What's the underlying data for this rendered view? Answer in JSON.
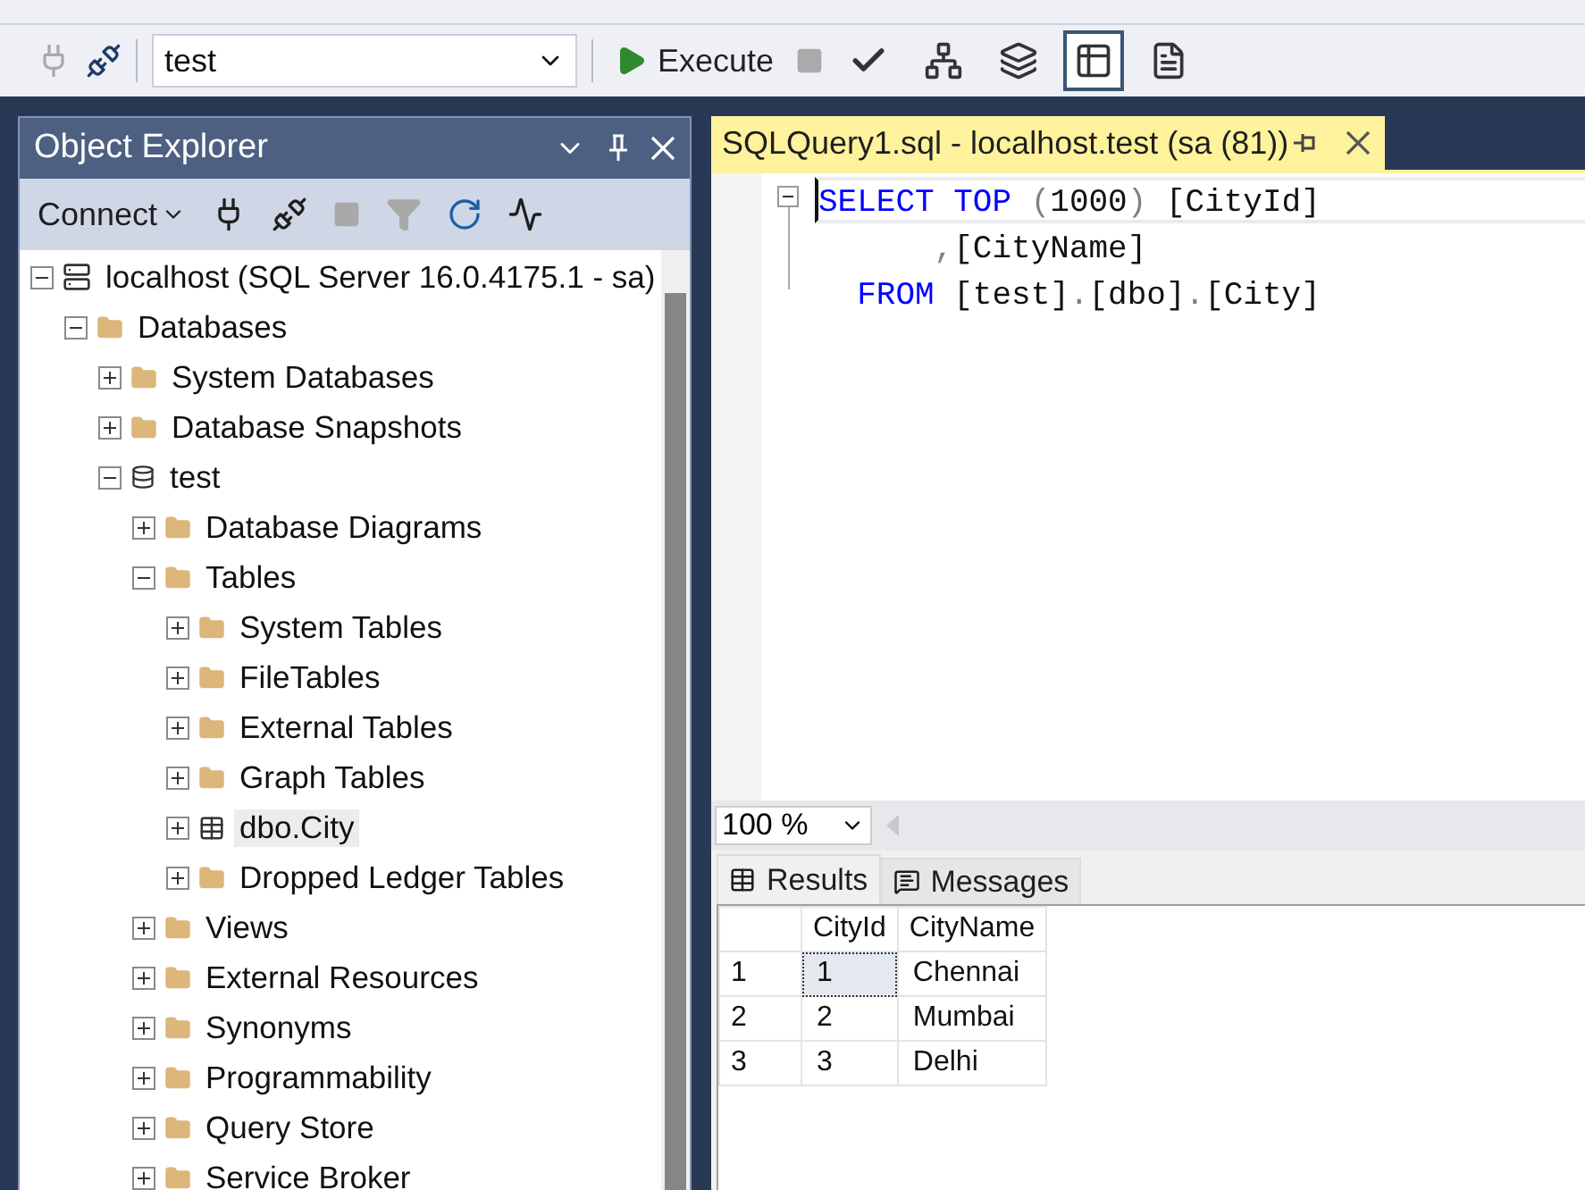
{
  "toolbar": {
    "database": "test",
    "execute": "Execute",
    "buttons": [
      {
        "kind": "check"
      },
      {
        "kind": "plan"
      },
      {
        "kind": "text",
        "selected": false
      },
      {
        "kind": "grid",
        "selected": true
      },
      {
        "kind": "file",
        "selected": false
      }
    ]
  },
  "object_explorer": {
    "title": "Object Explorer",
    "connect": "Connect",
    "tools": [
      {
        "kind": "plug",
        "disabled": false
      },
      {
        "kind": "unplug",
        "disabled": false
      },
      {
        "kind": "stop",
        "disabled": true
      },
      {
        "kind": "filter",
        "disabled": true
      },
      {
        "kind": "refresh",
        "disabled": false
      },
      {
        "kind": "activity",
        "disabled": false
      }
    ],
    "tree": [
      {
        "label": "localhost (SQL Server 16.0.4175.1 - sa)",
        "kind": "server",
        "expanded": true,
        "selected": false,
        "children": [
          {
            "label": "Databases",
            "kind": "folder",
            "expanded": true,
            "selected": false,
            "children": [
              {
                "label": "System Databases",
                "kind": "folder",
                "expanded": false,
                "selected": false
              },
              {
                "label": "Database Snapshots",
                "kind": "folder",
                "expanded": false,
                "selected": false
              },
              {
                "label": "test",
                "kind": "database",
                "expanded": true,
                "selected": false,
                "children": [
                  {
                    "label": "Database Diagrams",
                    "kind": "folder",
                    "expanded": false,
                    "selected": false
                  },
                  {
                    "label": "Tables",
                    "kind": "folder",
                    "expanded": true,
                    "selected": false,
                    "children": [
                      {
                        "label": "System Tables",
                        "kind": "folder",
                        "expanded": false,
                        "selected": false
                      },
                      {
                        "label": "FileTables",
                        "kind": "folder",
                        "expanded": false,
                        "selected": false
                      },
                      {
                        "label": "External Tables",
                        "kind": "folder",
                        "expanded": false,
                        "selected": false
                      },
                      {
                        "label": "Graph Tables",
                        "kind": "folder",
                        "expanded": false,
                        "selected": false
                      },
                      {
                        "label": "dbo.City",
                        "kind": "table",
                        "expanded": false,
                        "selected": true
                      },
                      {
                        "label": "Dropped Ledger Tables",
                        "kind": "folder",
                        "expanded": false,
                        "selected": false
                      }
                    ]
                  },
                  {
                    "label": "Views",
                    "kind": "folder",
                    "expanded": false,
                    "selected": false
                  },
                  {
                    "label": "External Resources",
                    "kind": "folder",
                    "expanded": false,
                    "selected": false
                  },
                  {
                    "label": "Synonyms",
                    "kind": "folder",
                    "expanded": false,
                    "selected": false
                  },
                  {
                    "label": "Programmability",
                    "kind": "folder",
                    "expanded": false,
                    "selected": false
                  },
                  {
                    "label": "Query Store",
                    "kind": "folder",
                    "expanded": false,
                    "selected": false
                  },
                  {
                    "label": "Service Broker",
                    "kind": "folder",
                    "expanded": false,
                    "selected": false
                  }
                ]
              }
            ]
          }
        ]
      }
    ]
  },
  "editor": {
    "tab_title": "SQLQuery1.sql - localhost.test (sa (81))",
    "code": [
      [
        {
          "text": "SELECT",
          "kind": "keyword"
        },
        {
          "text": " TOP",
          "kind": "keyword"
        },
        {
          "text": " (",
          "kind": "punct"
        },
        {
          "text": "1000",
          "kind": "plain"
        },
        {
          "text": ")",
          "kind": "punct"
        },
        {
          "text": " [CityId]",
          "kind": "plain"
        }
      ],
      [
        {
          "text": "      ,",
          "kind": "punct"
        },
        {
          "text": "[CityName]",
          "kind": "plain"
        }
      ],
      [
        {
          "text": "  FROM",
          "kind": "keyword"
        },
        {
          "text": " [test]",
          "kind": "plain"
        },
        {
          "text": ".",
          "kind": "punct"
        },
        {
          "text": "[dbo]",
          "kind": "plain"
        },
        {
          "text": ".",
          "kind": "punct"
        },
        {
          "text": "[City]",
          "kind": "plain"
        }
      ]
    ],
    "zoom": "100 %"
  },
  "results": {
    "tabs": [
      {
        "label": "Results",
        "kind": "grid",
        "selected": true
      },
      {
        "label": "Messages",
        "kind": "messages",
        "selected": false
      }
    ],
    "columns": [
      "CityId",
      "CityName"
    ],
    "rows": [
      {
        "number": "1",
        "cells": [
          "1",
          "Chennai"
        ],
        "selected": true
      },
      {
        "number": "2",
        "cells": [
          "2",
          "Mumbai"
        ],
        "selected": false
      },
      {
        "number": "3",
        "cells": [
          "3",
          "Delhi"
        ],
        "selected": false
      }
    ]
  }
}
